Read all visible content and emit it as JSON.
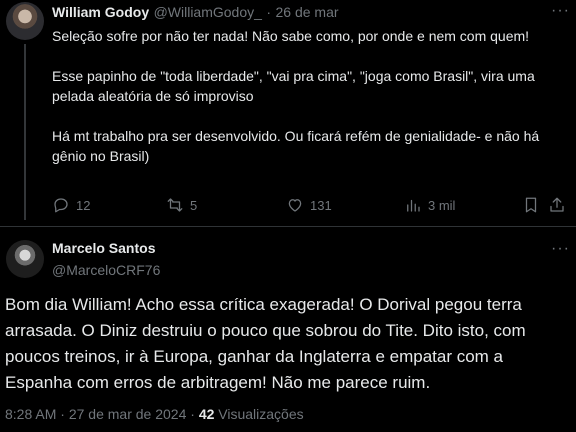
{
  "tweet": {
    "author_name": "William Godoy",
    "author_handle": "@WilliamGodoy_",
    "separator": "·",
    "date": "26 de mar",
    "more": "···",
    "paragraphs": [
      "Seleção sofre por não ter nada! Não sabe como, por onde e nem com quem!",
      "Esse papinho de \"toda liberdade\", \"vai pra cima\", \"joga como Brasil\", vira uma pelada aleatória de só improviso",
      "Há mt trabalho pra ser desenvolvido. Ou ficará refém de genialidade- e não há gênio no Brasil)"
    ],
    "actions": {
      "replies": "12",
      "retweets": "5",
      "likes": "131",
      "views": "3 mil"
    }
  },
  "reply": {
    "author_name": "Marcelo Santos",
    "author_handle": "@MarceloCRF76",
    "text": "Bom dia William! Acho essa crítica exagerada! O Dorival pegou terra arrasada. O Diniz destruiu o pouco que sobrou do Tite. Dito isto, com poucos treinos, ir à Europa, ganhar da Inglaterra e empatar com a Espanha com erros de arbitragem! Não me parece ruim.",
    "time": "8:28 AM",
    "separator": "·",
    "date": "27 de mar de 2024",
    "views_count": "42",
    "views_label": "Visualizações"
  },
  "colors": {
    "background": "#000000",
    "text": "#e7e9ea",
    "muted": "#71767b",
    "divider": "#2f3336"
  }
}
